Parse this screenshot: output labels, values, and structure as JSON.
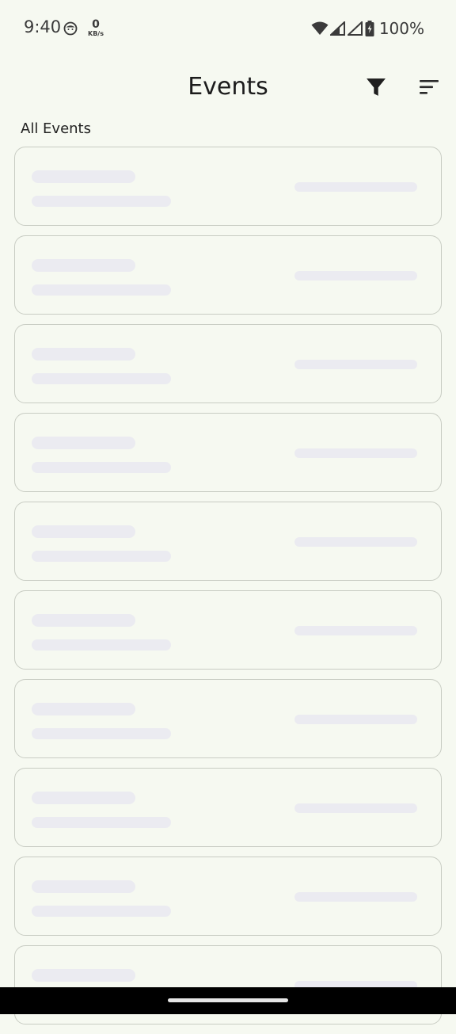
{
  "status_bar": {
    "time": "9:40",
    "net_speed_value": "0",
    "net_speed_unit": "KB/s",
    "battery": "100%",
    "icons": [
      "face-notification-icon",
      "wifi-icon",
      "cell-signal-icon",
      "cell-signal-icon",
      "battery-charging-icon"
    ]
  },
  "app_bar": {
    "title": "Events",
    "actions": [
      "filter-icon",
      "sort-icon"
    ]
  },
  "section": {
    "label": "All Events"
  },
  "events": {
    "state": "loading",
    "placeholder_count": 10
  },
  "colors": {
    "background": "#f6f9f1",
    "card_border": "#c8ccc3",
    "skeleton": "#ebebf1",
    "nav_bar": "#000000"
  }
}
